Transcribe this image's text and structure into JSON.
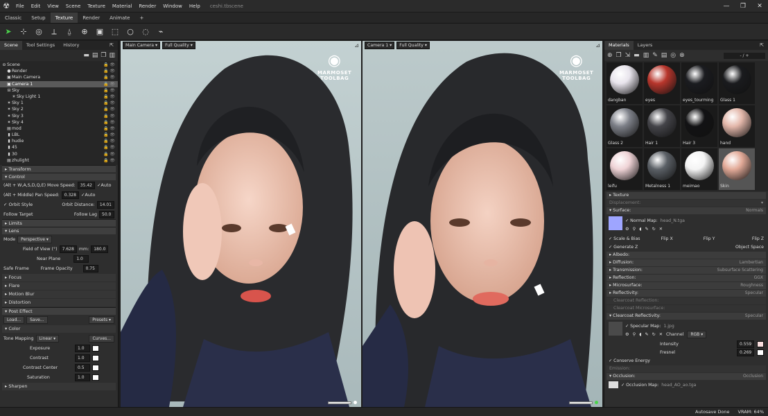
{
  "menubar": {
    "items": [
      "File",
      "Edit",
      "View",
      "Scene",
      "Texture",
      "Material",
      "Render",
      "Window",
      "Help"
    ],
    "project": "ceshi.tbscene",
    "win": [
      "—",
      "❐",
      "✕"
    ]
  },
  "tabs": [
    "Classic",
    "Setup",
    "Texture",
    "Render",
    "Animate",
    "+"
  ],
  "scene_panel": {
    "tabs": [
      "Scene",
      "Tool Settings",
      "History"
    ],
    "tree": [
      {
        "label": "Scene",
        "indent": 0,
        "icon": "⊖"
      },
      {
        "label": "Render",
        "indent": 1,
        "icon": "●"
      },
      {
        "label": "Main Camera",
        "indent": 1,
        "icon": "▣"
      },
      {
        "label": "Camera 1",
        "indent": 1,
        "icon": "▣",
        "selected": true
      },
      {
        "label": "Sky",
        "indent": 1,
        "icon": "⊟"
      },
      {
        "label": "Sky Light 1",
        "indent": 2,
        "icon": "☀"
      },
      {
        "label": "Sky 1",
        "indent": 1,
        "icon": "✶"
      },
      {
        "label": "Sky 2",
        "indent": 1,
        "icon": "✶"
      },
      {
        "label": "Sky 3",
        "indent": 1,
        "icon": "✶"
      },
      {
        "label": "Sky 4",
        "indent": 1,
        "icon": "✶"
      },
      {
        "label": "mod",
        "indent": 1,
        "icon": "▤"
      },
      {
        "label": "LBL",
        "indent": 1,
        "icon": "▮"
      },
      {
        "label": "hudie",
        "indent": 1,
        "icon": "▮"
      },
      {
        "label": "45",
        "indent": 1,
        "icon": "▮"
      },
      {
        "label": "30",
        "indent": 1,
        "icon": "▮"
      },
      {
        "label": "zhulight",
        "indent": 1,
        "icon": "▤"
      }
    ],
    "transform": "Transform",
    "control": "Control",
    "move_label": "(Alt + W,A,S,D,Q,E)  Move Speed:",
    "move_speed": "35.42",
    "auto1": "✓Auto",
    "pan_label": "(Alt + Middle)       Pan Speed:",
    "pan_speed": "0.328",
    "auto2": "✓Auto",
    "orbit_style": "✓ Orbit Style",
    "orbit_distance_label": "Orbit Distance:",
    "orbit_distance": "14.01",
    "follow_target": "Follow Target",
    "follow_lag_label": "Follow Lag",
    "follow_lag": "50.0",
    "limits": "Limits",
    "lens": "Lens",
    "mode_label": "Mode",
    "mode_value": "Perspective",
    "fov_label": "Field of View (°)",
    "fov_value": "7.628",
    "mm_label": "mm:",
    "mm_value": "180.0",
    "near_plane_label": "Near Plane",
    "near_plane_value": "1.0",
    "safe_frame": "Safe Frame",
    "frame_opacity_label": "Frame Opacity",
    "frame_opacity_value": "0.75",
    "focus": "Focus",
    "flare": "Flare",
    "motion_blur": "Motion Blur",
    "distortion": "Distortion",
    "post_effect": "Post Effect",
    "load": "Load...",
    "save": "Save...",
    "presets": "Presets ▾",
    "color": "Color",
    "tone_mapping_label": "Tone Mapping",
    "tone_mapping_value": "Linear",
    "curves": "Curves...",
    "exposure_label": "Exposure",
    "exposure_value": "1.0",
    "contrast_label": "Contrast",
    "contrast_value": "1.0",
    "contrast_center_label": "Contrast Center",
    "contrast_center_value": "0.5",
    "saturation_label": "Saturation",
    "saturation_value": "1.0",
    "sharpen": "Sharpen"
  },
  "viewport1": {
    "camera": "Main Camera",
    "quality": "Full Quality"
  },
  "viewport2": {
    "camera": "Camera 1",
    "quality": "Full Quality"
  },
  "watermark": {
    "line1": "MARMOSET",
    "line2": "TOOLBAG"
  },
  "materials_panel": {
    "tabs": [
      "Materials",
      "Layers"
    ],
    "counter": "- / +",
    "materials": [
      {
        "name": "dangban",
        "color": "#e8e4ec"
      },
      {
        "name": "eyes",
        "color": "#b8362c"
      },
      {
        "name": "eyes_tourming",
        "color": "#1b1c20"
      },
      {
        "name": "Glass 1",
        "color": "#1a1b1e"
      },
      {
        "name": "Glass 2",
        "color": "#7d8088"
      },
      {
        "name": "Hair 1",
        "color": "#444449"
      },
      {
        "name": "Hair 3",
        "color": "#121214"
      },
      {
        "name": "hand",
        "color": "#e3b7aa"
      },
      {
        "name": "leifu",
        "color": "#efd3d6"
      },
      {
        "name": "Metalness 1",
        "color": "#5b6066"
      },
      {
        "name": "meimao",
        "color": "#f4f4f4"
      },
      {
        "name": "Skin",
        "color": "#e2aa98",
        "selected": true
      }
    ],
    "texture": "Texture",
    "displacement": "Displacement:",
    "surface": "Surface:",
    "surface_value": "Normals",
    "normal_map_label": "✓ Normal Map:",
    "normal_map_file": "head_N.tga",
    "scale_bias": "✓ Scale & Bias",
    "flip_x": "Flip X",
    "flip_y": "Flip Y",
    "flip_z": "Flip Z",
    "generate_z": "✓ Generate Z",
    "object_space": "Object Space",
    "albedo": "Albedo:",
    "diffusion": "Diffusion:",
    "diffusion_value": "Lambertian",
    "transmission": "Transmission:",
    "transmission_value": "Subsurface Scattering",
    "reflection": "Reflection:",
    "reflection_value": "GGX",
    "microsurface": "Microsurface:",
    "microsurface_value": "Roughness",
    "reflectivity": "Reflectivity:",
    "reflectivity_value": "Specular",
    "clearcoat_reflection": "Clearcoat Reflection:",
    "clearcoat_microsurface": "Clearcoat Microsurface:",
    "clearcoat_reflectivity": "Clearcoat Reflectivity:",
    "clearcoat_reflectivity_value": "Specular",
    "specular_map_label": "✓ Specular Map:",
    "specular_map_file": "1.jpg",
    "channel_label": "Channel",
    "channel_value": "RGB",
    "intensity_label": "Intensity",
    "intensity_value": "0.559",
    "fresnel_label": "Fresnel",
    "fresnel_value": "0.269",
    "conserve_energy": "✓ Conserve Energy",
    "emission": "Emission:",
    "occlusion": "Occlusion:",
    "occlusion_value": "Occlusion",
    "occlusion_map_label": "✓ Occlusion Map:",
    "occlusion_map_file": "head_AO_ao.tga"
  },
  "status": {
    "autosave": "Autosave Done",
    "vram": "VRAM: 64%"
  },
  "colors": {
    "accent": "#4bd34b",
    "panel": "#2e2e2e",
    "header": "#3c3c3c"
  }
}
